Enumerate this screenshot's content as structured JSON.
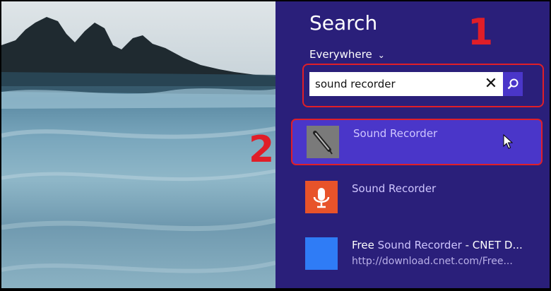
{
  "search_panel": {
    "title": "Search",
    "scope": "Everywhere",
    "query": "sound recorder"
  },
  "annotations": {
    "step1": "1",
    "step2": "2"
  },
  "results": [
    {
      "label": "Sound Recorder",
      "icon": "microphone-desktop-icon"
    },
    {
      "label": "Sound Recorder",
      "icon": "microphone-app-icon",
      "tile_color": "#e8532a"
    },
    {
      "prefix": "Free ",
      "label": "Sound Recorder",
      "suffix": " - CNET D...",
      "url": "http://download.cnet.com/Free...",
      "tile_color": "#2f7cf6"
    }
  ],
  "colors": {
    "panel_bg": "#2a1f7a",
    "accent": "#4a36c9",
    "highlight_border": "#e01e28"
  }
}
